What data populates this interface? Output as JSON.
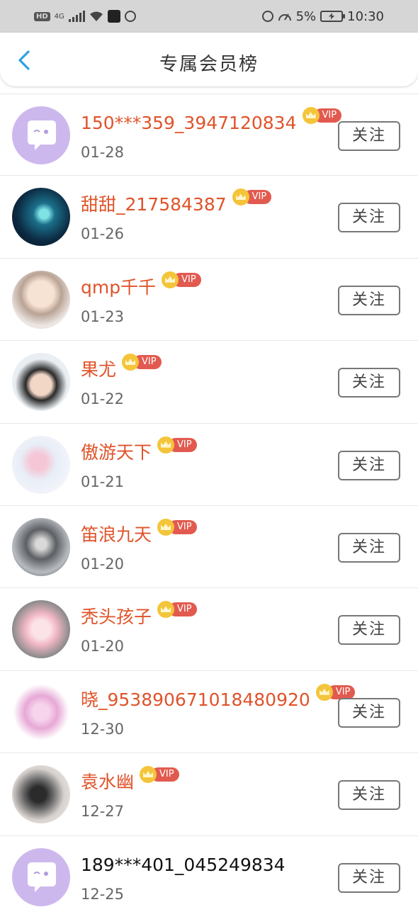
{
  "status_bar": {
    "hd": "HD",
    "network": "4G",
    "battery_percent": "5%",
    "time": "10:30"
  },
  "header": {
    "title": "专属会员榜"
  },
  "vip_label": "VIP",
  "members": [
    {
      "name": "150***359_3947120834",
      "date": "01-28",
      "vip": true,
      "follow_label": "关注",
      "avatar": "default"
    },
    {
      "name": "甜甜_217584387",
      "date": "01-26",
      "vip": true,
      "follow_label": "关注",
      "avatar": "photo"
    },
    {
      "name": "qmp千千",
      "date": "01-23",
      "vip": true,
      "follow_label": "关注",
      "avatar": "photo"
    },
    {
      "name": "果尤",
      "date": "01-22",
      "vip": true,
      "follow_label": "关注",
      "avatar": "photo"
    },
    {
      "name": "傲游天下",
      "date": "01-21",
      "vip": true,
      "follow_label": "关注",
      "avatar": "photo"
    },
    {
      "name": "笛浪九天",
      "date": "01-20",
      "vip": true,
      "follow_label": "关注",
      "avatar": "photo"
    },
    {
      "name": "秃头孩子",
      "date": "01-20",
      "vip": true,
      "follow_label": "关注",
      "avatar": "photo"
    },
    {
      "name": "晓_953890671018480920",
      "date": "12-30",
      "vip": true,
      "follow_label": "关注",
      "avatar": "photo"
    },
    {
      "name": "袁水幽",
      "date": "12-27",
      "vip": true,
      "follow_label": "关注",
      "avatar": "photo"
    },
    {
      "name": "189***401_045249834",
      "date": "12-25",
      "vip": false,
      "follow_label": "关注",
      "avatar": "default"
    }
  ],
  "colors": {
    "vip_name": "#e0532a",
    "plain_name": "#111111",
    "vip_badge": "#e25a4f",
    "crown": "#f4c53a",
    "default_avatar": "#cdb8ee",
    "back_arrow": "#2ea0e8"
  }
}
